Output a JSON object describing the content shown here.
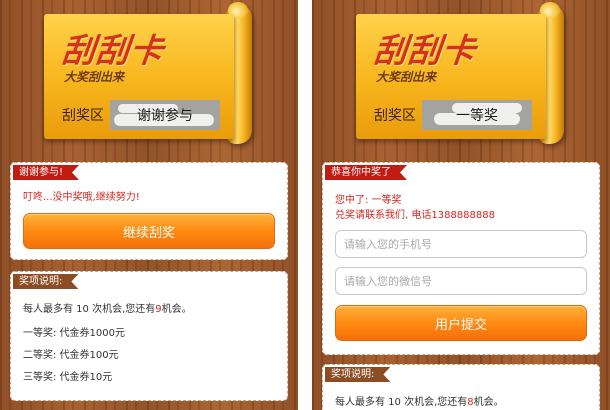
{
  "colors": {
    "accent_red": "#c01c12",
    "button_orange": "#ff8a12",
    "ticket_yellow": "#f7b51c",
    "wood_brown": "#9a5529"
  },
  "ticket": {
    "title": "刮刮卡",
    "subtitle": "大奖刮出来",
    "area_label": "刮奖区"
  },
  "left": {
    "ticket_result": "谢谢参与",
    "status_panel": {
      "tag": "谢谢参与!",
      "message": "叮咚...没中奖哦,继续努力!",
      "button_label": "继续刮奖"
    },
    "rules_panel": {
      "tag": "奖项说明:",
      "chances_prefix": "每人最多有 10 次机会,您还有",
      "chances_remaining": "9",
      "chances_suffix": "机会。",
      "prizes": [
        "一等奖: 代金券1000元",
        "二等奖: 代金券100元",
        "三等奖: 代金券10元"
      ]
    }
  },
  "right": {
    "ticket_result": "一等奖",
    "status_panel": {
      "tag": "恭喜你中奖了",
      "won_line": "您中了: 一等奖",
      "contact_line": "兑奖请联系我们, 电话1388888888",
      "phone_placeholder": "请输入您的手机号",
      "wechat_placeholder": "请输入您的微信号",
      "button_label": "用户提交"
    },
    "rules_panel": {
      "tag": "奖项说明:",
      "chances_prefix": "每人最多有 10 次机会,您还有",
      "chances_remaining": "8",
      "chances_suffix": "机会。"
    }
  }
}
